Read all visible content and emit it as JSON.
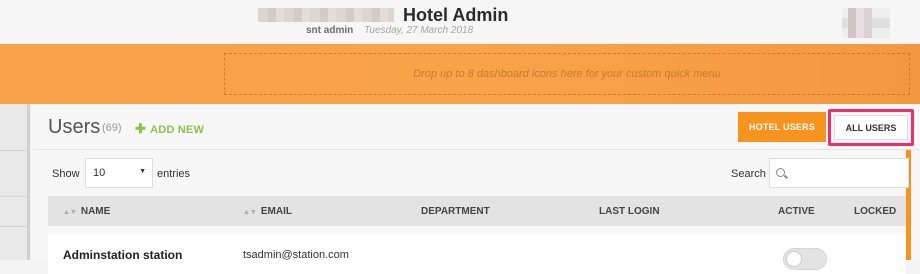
{
  "header": {
    "title": "Hotel Admin",
    "user_name": "snt admin",
    "date": "Tuesday, 27 March 2018"
  },
  "quick_menu": {
    "placeholder": "Drop up to 8 dashboard icons here for your custom quick menu"
  },
  "users_panel": {
    "title": "Users",
    "count": "(69)",
    "add_new_label": "ADD NEW",
    "tabs": [
      {
        "label": "HOTEL USERS",
        "active": true
      },
      {
        "label": "ALL USERS",
        "active": false
      }
    ],
    "length": {
      "show_label": "Show",
      "selected": "10",
      "entries_label": "entries"
    },
    "search": {
      "label": "Search",
      "value": ""
    },
    "columns": [
      "NAME",
      "EMAIL",
      "DEPARTMENT",
      "LAST LOGIN",
      "ACTIVE",
      "LOCKED"
    ],
    "rows": [
      {
        "name": "Adminstation station",
        "email": "tsadmin@station.com",
        "department": "",
        "last_login": "",
        "active": false
      }
    ]
  },
  "colors": {
    "accent_orange": "#f7941d",
    "add_green": "#8bc34a",
    "highlight_pink": "#ee2d6a"
  }
}
